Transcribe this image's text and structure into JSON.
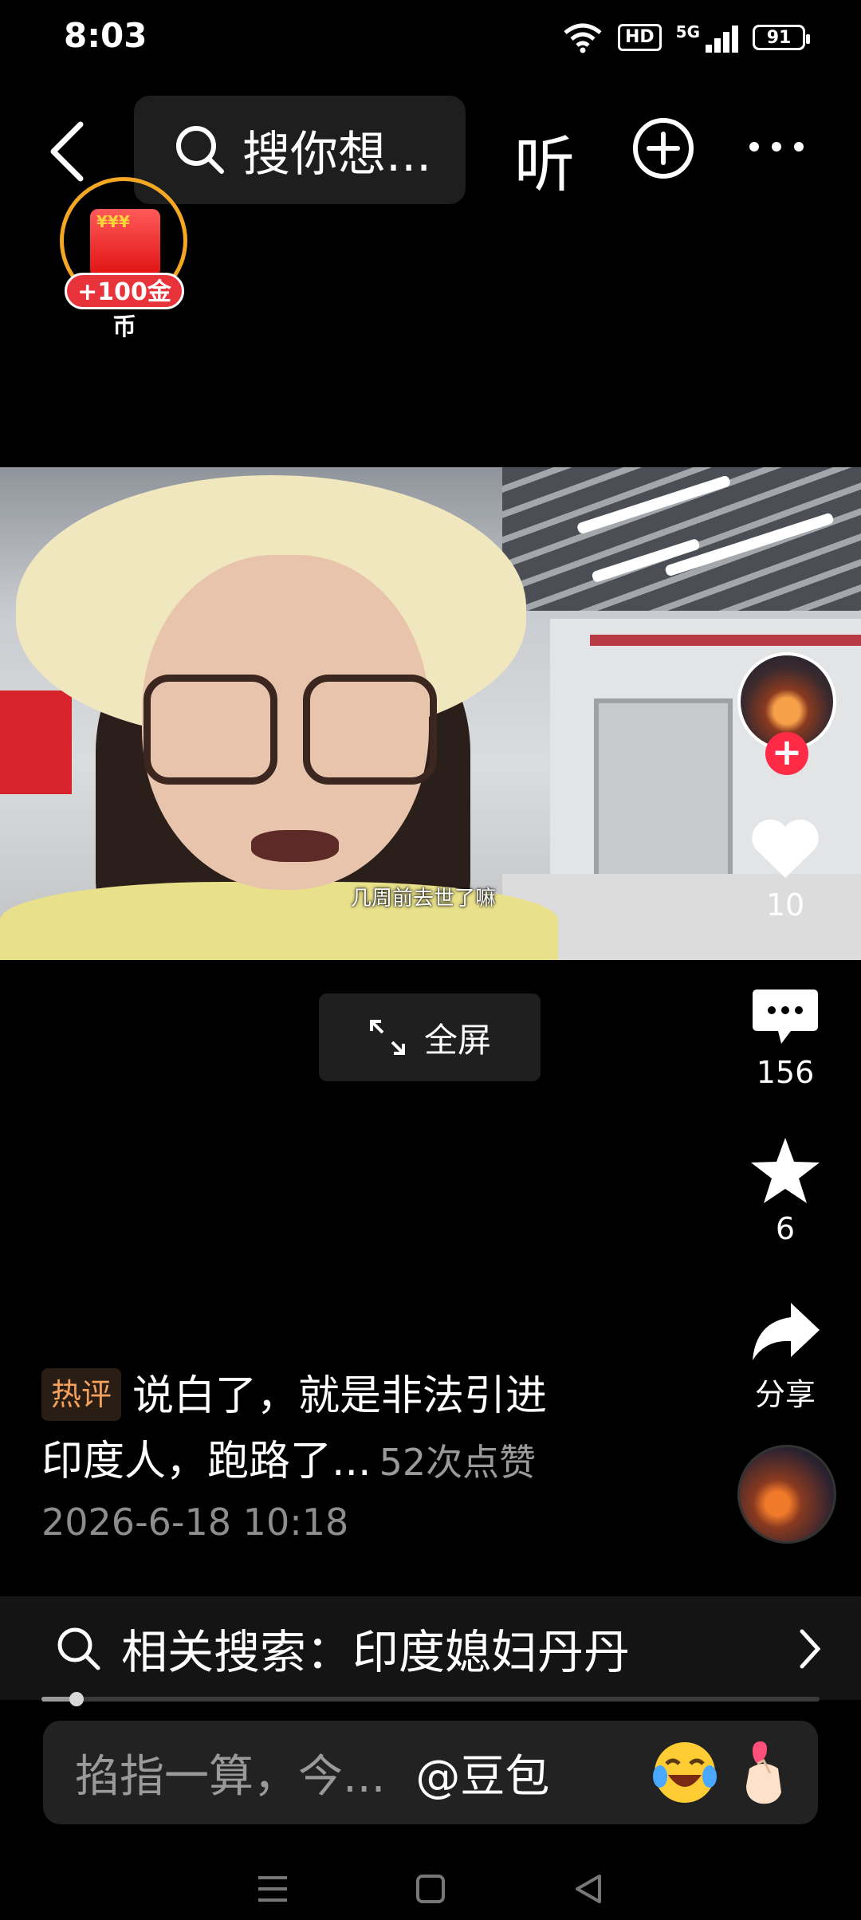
{
  "status_bar": {
    "time": "8:03",
    "hd": "HD",
    "network": "5G",
    "battery": "91"
  },
  "top_bar": {
    "search_placeholder": "搜你想...",
    "listen_label": "听"
  },
  "reward": {
    "badge": "+100金币"
  },
  "video": {
    "caption": "几周前去世了嘛",
    "fullscreen_label": "全屏"
  },
  "actions": {
    "like_count": "10",
    "comment_count": "156",
    "favorite_count": "6",
    "share_label": "分享"
  },
  "comment": {
    "tag": "热评",
    "text_line1": "说白了，就是非法引进",
    "text_line2": "印度人，跑路了...",
    "likes": "52次点赞",
    "date": "2026-6-18 10:18"
  },
  "related_search": {
    "label": "相关搜索：印度媳妇丹丹"
  },
  "playback": {
    "progress_fraction": 0.045
  },
  "input_bar": {
    "placeholder": "掐指一算，今...",
    "mention": "@豆包"
  },
  "colors": {
    "accent": "#ff2a46",
    "hot_tag": "#f3a15c",
    "coin_ring": "#f5a623"
  },
  "icons": [
    "back-icon",
    "search-icon",
    "add-circle-icon",
    "more-icon",
    "fullscreen-icon",
    "heart-icon",
    "comment-icon",
    "star-icon",
    "share-icon",
    "chevron-right-icon",
    "laughing-emoji-icon",
    "finger-heart-emoji-icon"
  ]
}
